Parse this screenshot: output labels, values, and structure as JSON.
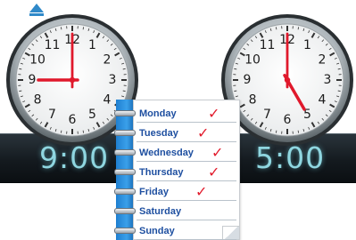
{
  "clocks": {
    "left": {
      "digital_time": "9:00",
      "numbers": [
        "12",
        "1",
        "2",
        "3",
        "4",
        "5",
        "6",
        "7",
        "8",
        "9",
        "10",
        "11"
      ],
      "hour": 9,
      "minute": 0
    },
    "right": {
      "digital_time": "5:00",
      "numbers": [
        "12",
        "1",
        "2",
        "3",
        "4",
        "5",
        "6",
        "7",
        "8",
        "9",
        "10",
        "11"
      ],
      "hour": 5,
      "minute": 0
    }
  },
  "notepad": {
    "days": [
      {
        "label": "Monday",
        "checked": true
      },
      {
        "label": "Tuesday",
        "checked": true
      },
      {
        "label": "Wednesday",
        "checked": true
      },
      {
        "label": "Thursday",
        "checked": true
      },
      {
        "label": "Friday",
        "checked": true
      },
      {
        "label": "Saturday",
        "checked": false
      },
      {
        "label": "Sunday",
        "checked": false
      }
    ],
    "check_glyph": "✓"
  },
  "colors": {
    "hand_color": "#e0192c",
    "check_color": "#e21b2c",
    "day_text_color": "#1e4fa0",
    "digital_color": "#8fd6e0",
    "binding_color": "#2b8ee0"
  }
}
